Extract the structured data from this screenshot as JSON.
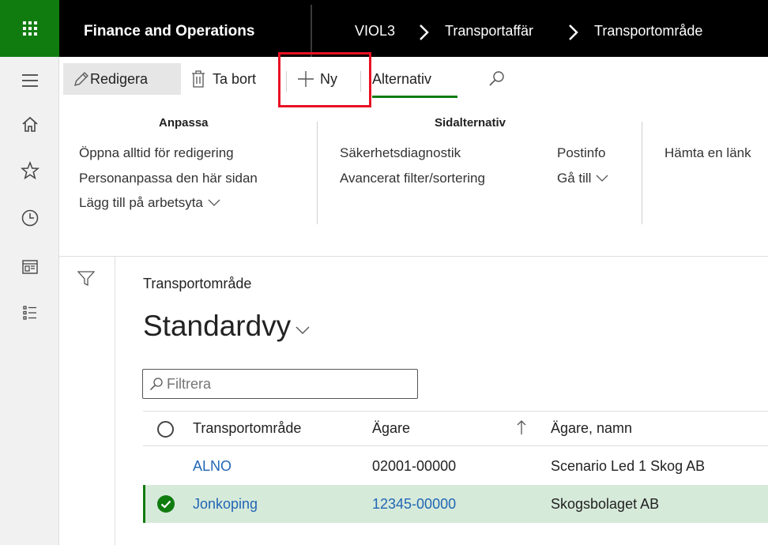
{
  "topbar": {
    "app_name": "Finance and Operations",
    "breadcrumb": [
      "VIOL3",
      "Transportaffär",
      "Transportområde"
    ]
  },
  "actions": {
    "edit": "Redigera",
    "delete": "Ta bort",
    "new": "Ny",
    "options_tab": "Alternativ"
  },
  "ribbon": {
    "customize": {
      "title": "Anpassa",
      "items": [
        "Öppna alltid för redigering",
        "Personanpassa den här sidan",
        "Lägg till på arbetsyta"
      ]
    },
    "page_options": {
      "title": "Sidalternativ",
      "items": [
        "Säkerhetsdiagnostik",
        "Avancerat filter/sortering"
      ],
      "record_info": "Postinfo",
      "go_to": "Gå till",
      "get_link": "Hämta en länk"
    }
  },
  "content": {
    "page_caption": "Transportområde",
    "view_name": "Standardvy",
    "filter_placeholder": "Filtrera",
    "columns": [
      "Transportområde",
      "Ägare",
      "Ägare, namn"
    ],
    "rows": [
      {
        "area": "ALNO",
        "owner": "02001-00000",
        "owner_name": "Scenario Led 1 Skog AB",
        "selected": false
      },
      {
        "area": "Jonkoping",
        "owner": "12345-00000",
        "owner_name": "Skogsbolaget AB",
        "selected": true
      }
    ]
  },
  "colors": {
    "brand_green": "#107c10",
    "link_blue": "#2266b5",
    "highlight_red": "#e81123",
    "selected_row": "#d6eada"
  }
}
